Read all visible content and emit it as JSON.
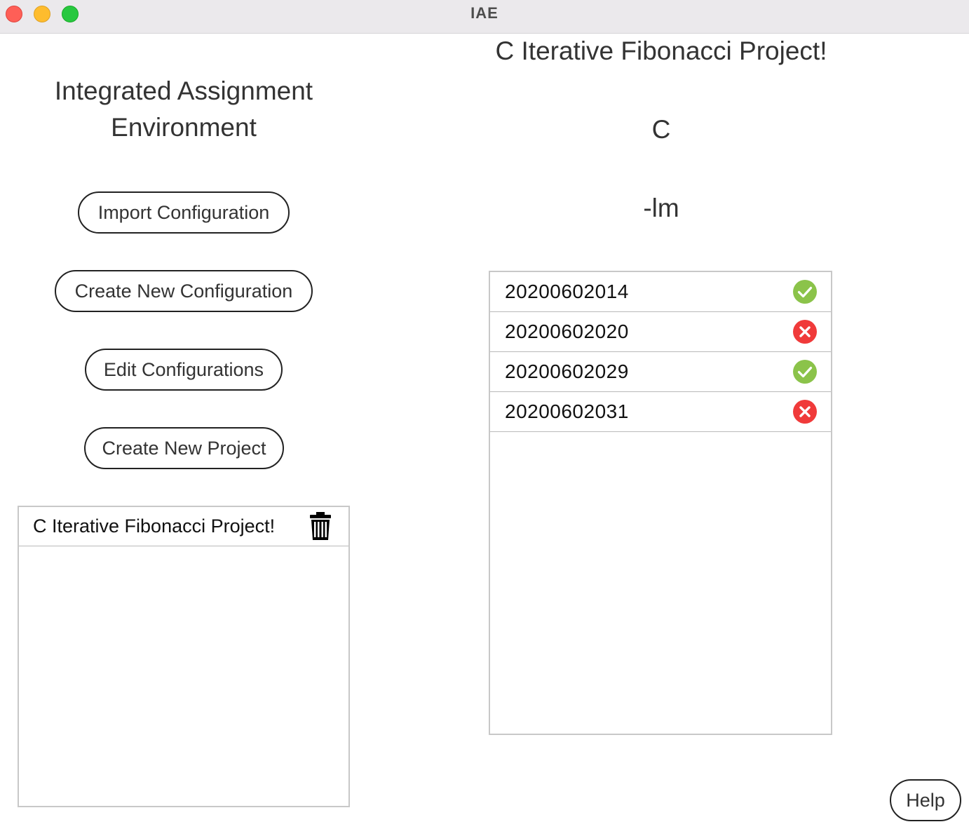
{
  "window": {
    "title": "IAE"
  },
  "sidebar": {
    "heading_line1": "Integrated Assignment",
    "heading_line2": "Environment",
    "buttons": {
      "import": "Import Configuration",
      "create_config": "Create New Configuration",
      "edit": "Edit Configurations",
      "create_project": "Create New Project"
    },
    "projects": [
      {
        "name": "C Iterative Fibonacci Project!",
        "action_icon": "trash-icon"
      }
    ]
  },
  "project": {
    "title": "C Iterative Fibonacci Project!",
    "language": "C",
    "flags": "-lm",
    "submissions": [
      {
        "id": "20200602014",
        "status": "pass",
        "status_icon": "check-circle-icon"
      },
      {
        "id": "20200602020",
        "status": "fail",
        "status_icon": "x-circle-icon"
      },
      {
        "id": "20200602029",
        "status": "pass",
        "status_icon": "check-circle-icon"
      },
      {
        "id": "20200602031",
        "status": "fail",
        "status_icon": "x-circle-icon"
      }
    ]
  },
  "help": {
    "label": "Help"
  },
  "colors": {
    "pass": "#8bc34a",
    "fail": "#f03a3a",
    "titlebar": "#ebe9ec"
  }
}
